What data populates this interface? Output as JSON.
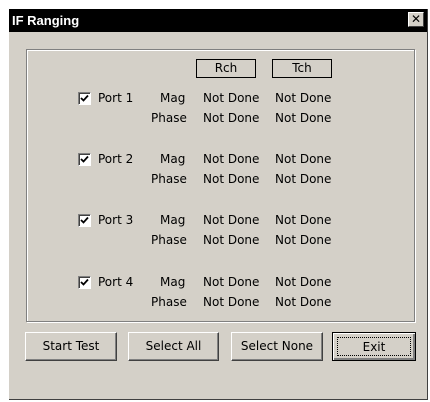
{
  "window": {
    "title": "IF Ranging",
    "close_glyph": "✕"
  },
  "columns": {
    "rch": "Rch",
    "tch": "Tch"
  },
  "ports": [
    {
      "label": "Port 1",
      "checked": true,
      "mag_label": "Mag",
      "mag_rch": "Not Done",
      "mag_tch": "Not Done",
      "phase_label": "Phase",
      "phase_rch": "Not Done",
      "phase_tch": "Not Done"
    },
    {
      "label": "Port 2",
      "checked": true,
      "mag_label": "Mag",
      "mag_rch": "Not Done",
      "mag_tch": "Not Done",
      "phase_label": "Phase",
      "phase_rch": "Not Done",
      "phase_tch": "Not Done"
    },
    {
      "label": "Port 3",
      "checked": true,
      "mag_label": "Mag",
      "mag_rch": "Not Done",
      "mag_tch": "Not Done",
      "phase_label": "Phase",
      "phase_rch": "Not Done",
      "phase_tch": "Not Done"
    },
    {
      "label": "Port 4",
      "checked": true,
      "mag_label": "Mag",
      "mag_rch": "Not Done",
      "mag_tch": "Not Done",
      "phase_label": "Phase",
      "phase_rch": "Not Done",
      "phase_tch": "Not Done"
    }
  ],
  "buttons": {
    "start_test": "Start Test",
    "select_all": "Select All",
    "select_none": "Select None",
    "exit": "Exit"
  }
}
